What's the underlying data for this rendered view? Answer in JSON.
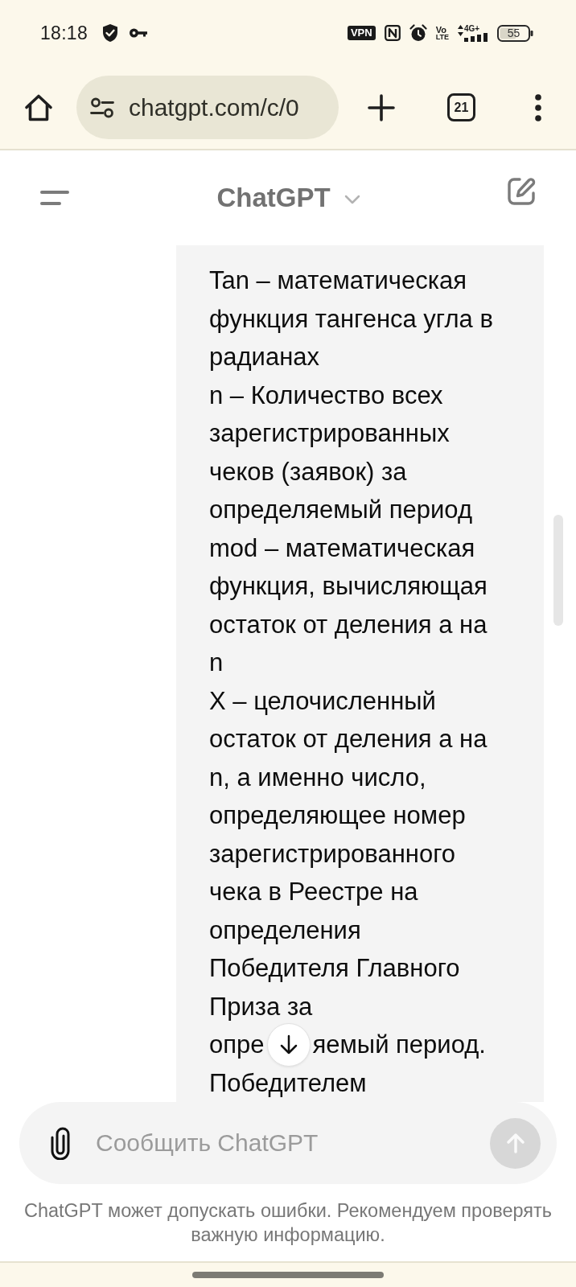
{
  "status_bar": {
    "time": "18:18",
    "vpn": "VPN",
    "volte": [
      "Vo",
      "LTE"
    ],
    "network": "4G+",
    "battery": "55"
  },
  "browser": {
    "url": "chatgpt.com/c/0",
    "tab_count": "21"
  },
  "header": {
    "title": "ChatGPT"
  },
  "message": {
    "blocks": [
      {
        "kind": "text",
        "text": "Tan – математическая\nфункция тангенса угла в\nрадианах"
      },
      {
        "kind": "text",
        "text": "n – Количество всех\nзарегистрированных\nчеков (заявок) за\nопределяемый период"
      },
      {
        "kind": "text",
        "text": "mod – математическая\nфункция, вычисляющая\nостаток от деления a на\nn"
      },
      {
        "kind": "text",
        "text": "X – целочисленный\nостаток от деления a на\nn, а именно число,\nопределяющее номер\nзарегистрированного\nчека в Реестре на\nопределения\nПобедителя Главного\nПриза за"
      },
      {
        "kind": "covered",
        "parts": [
          "опре",
          "яемый период."
        ]
      },
      {
        "kind": "text",
        "text": "Победителем"
      }
    ]
  },
  "composer": {
    "placeholder": "Сообщить ChatGPT",
    "send_button": {
      "disabled": true
    }
  },
  "disclaimer": "ChatGPT может допускать ошибки. Рекомендуем проверять важную информацию."
}
